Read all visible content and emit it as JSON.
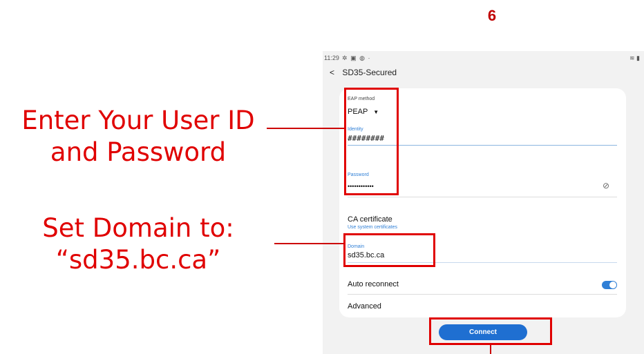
{
  "step_number": "6",
  "annotations": {
    "credentials_line1": "Enter Your User ID",
    "credentials_line2": "and Password",
    "domain_line1": "Set Domain to:",
    "domain_line2": "“sd35.bc.ca”"
  },
  "status_bar": {
    "time": "11:29",
    "icons": [
      "settings-icon",
      "image-icon",
      "globe-icon",
      "dot-icon"
    ],
    "right_icons": [
      "wifi-icon",
      "battery-icon"
    ]
  },
  "header": {
    "title": "SD35-Secured"
  },
  "form": {
    "eap_method_label": "EAP method",
    "eap_method_value": "PEAP",
    "identity_label": "Identity",
    "identity_value": "########",
    "password_label": "Password",
    "password_value": "••••••••••••",
    "ca_certificate_label": "CA certificate",
    "ca_certificate_value": "Use system certificates",
    "domain_label": "Domain",
    "domain_value": "sd35.bc.ca",
    "auto_reconnect_label": "Auto reconnect",
    "auto_reconnect_on": true,
    "advanced_label": "Advanced",
    "connect_label": "Connect"
  },
  "colors": {
    "annotation_red": "#e00000",
    "accent_blue": "#2f7fd6",
    "connect_button": "#1f6fd1"
  }
}
